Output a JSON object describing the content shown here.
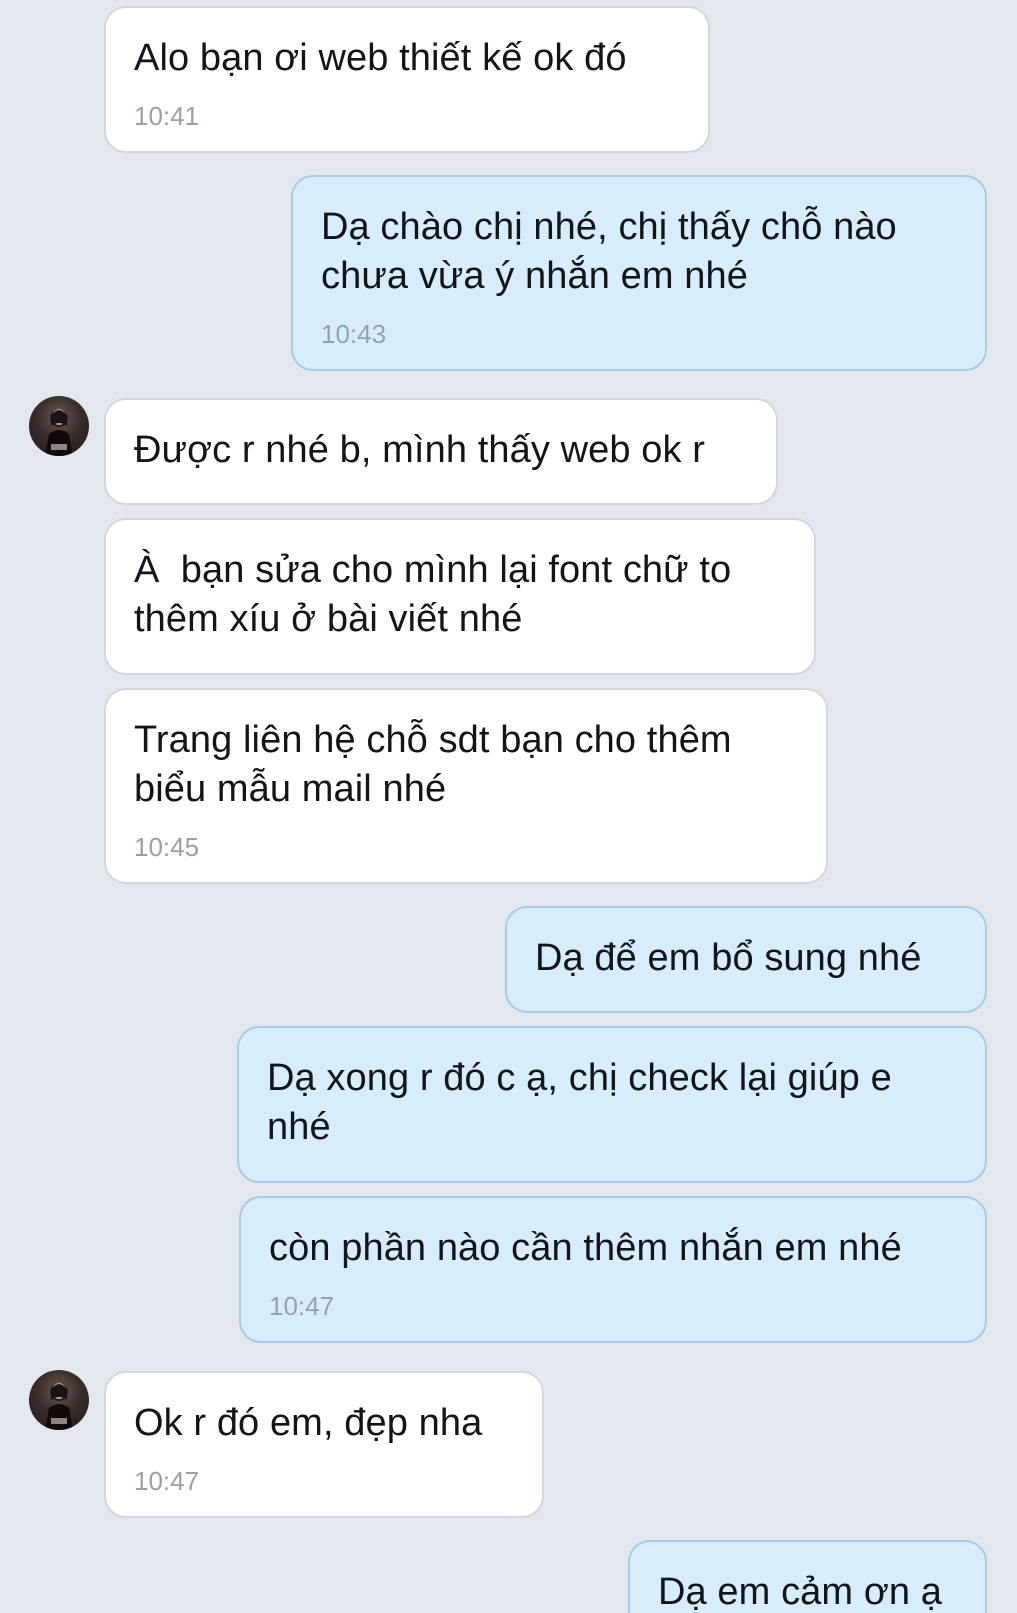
{
  "colors": {
    "background": "#e3e7ee",
    "incoming_bubble": "#ffffff",
    "outgoing_bubble": "#d8edfb",
    "outgoing_border": "#a9cbe6",
    "timestamp": "#9aa0a8"
  },
  "messages": [
    {
      "direction": "in",
      "text": "Alo bạn ơi web thiết kế ok đó",
      "time": "10:41"
    },
    {
      "direction": "out",
      "text": "Dạ chào chị nhé, chị thấy chỗ nào chưa vừa ý nhắn em nhé",
      "time": "10:43"
    },
    {
      "direction": "in",
      "text": "Được r nhé b, mình thấy web ok r",
      "time": ""
    },
    {
      "direction": "in",
      "text": "À  bạn sửa cho mình lại font chữ to thêm xíu ở bài viết nhé",
      "time": ""
    },
    {
      "direction": "in",
      "text": "Trang liên hệ chỗ sdt bạn cho thêm biểu mẫu mail nhé",
      "time": "10:45"
    },
    {
      "direction": "out",
      "text": "Dạ để em bổ sung nhé",
      "time": ""
    },
    {
      "direction": "out",
      "text": "Dạ xong r đó c ạ, chị check lại giúp e nhé",
      "time": ""
    },
    {
      "direction": "out",
      "text": "còn phần nào cần thêm nhắn em nhé",
      "time": "10:47"
    },
    {
      "direction": "in",
      "text": "Ok r đó em, đẹp nha",
      "time": "10:47"
    },
    {
      "direction": "out",
      "text": "Dạ em cảm ơn ạ",
      "time": ""
    }
  ],
  "avatars": [
    {
      "icon": "contact-avatar-icon"
    },
    {
      "icon": "contact-avatar-icon"
    }
  ]
}
